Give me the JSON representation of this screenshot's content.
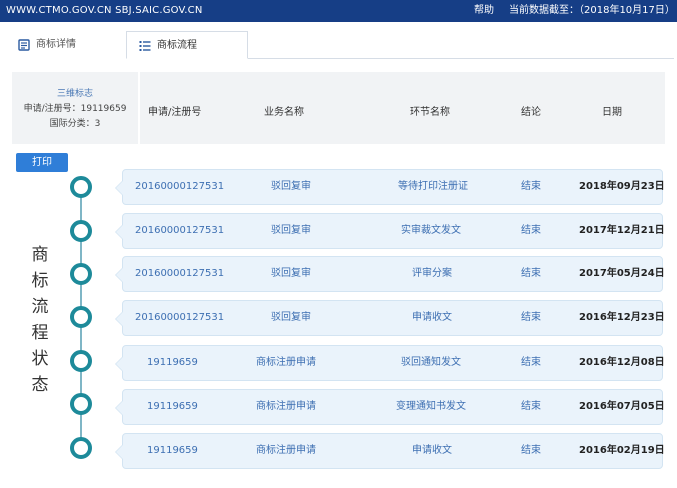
{
  "topbar": {
    "site": "WWW.CTMO.GOV.CN SBJ.SAIC.GOV.CN",
    "help": "帮助",
    "data_as_of": "当前数据截至：（2018年10月17日）",
    "bg": "#163e86"
  },
  "tabs": [
    {
      "label": "商标详情",
      "icon": "document-icon"
    },
    {
      "label": "商标流程",
      "icon": "list-icon"
    }
  ],
  "mark": {
    "type": "三维标志",
    "reg": "申请/注册号：19119659",
    "cls": "国际分类：3"
  },
  "columns": [
    "申请/注册号",
    "业务名称",
    "环节名称",
    "结论",
    "日期"
  ],
  "print_label": "打印",
  "vertical_title": [
    "商",
    "标",
    "流",
    "程",
    "状",
    "态"
  ],
  "rows": [
    {
      "number": "20160000127531",
      "business": "驳回复审",
      "step": "等待打印注册证",
      "result": "结束",
      "date": "2018年09月23日"
    },
    {
      "number": "20160000127531",
      "business": "驳回复审",
      "step": "实审裁文发文",
      "result": "结束",
      "date": "2017年12月21日"
    },
    {
      "number": "20160000127531",
      "business": "驳回复审",
      "step": "评审分案",
      "result": "结束",
      "date": "2017年05月24日"
    },
    {
      "number": "20160000127531",
      "business": "驳回复审",
      "step": "申请收文",
      "result": "结束",
      "date": "2016年12月23日"
    },
    {
      "number": "19119659",
      "business": "商标注册申请",
      "step": "驳回通知发文",
      "result": "结束",
      "date": "2016年12月08日"
    },
    {
      "number": "19119659",
      "business": "商标注册申请",
      "step": "变理通知书发文",
      "result": "结束",
      "date": "2016年07月05日"
    },
    {
      "number": "19119659",
      "business": "商标注册申请",
      "step": "申请收文",
      "result": "结束",
      "date": "2016年02月19日"
    }
  ],
  "colors": {
    "accent": "#2f7ed8",
    "node": "#1d8a9a",
    "row_bg": "#eaf3fb",
    "link": "#3d6fb2"
  }
}
